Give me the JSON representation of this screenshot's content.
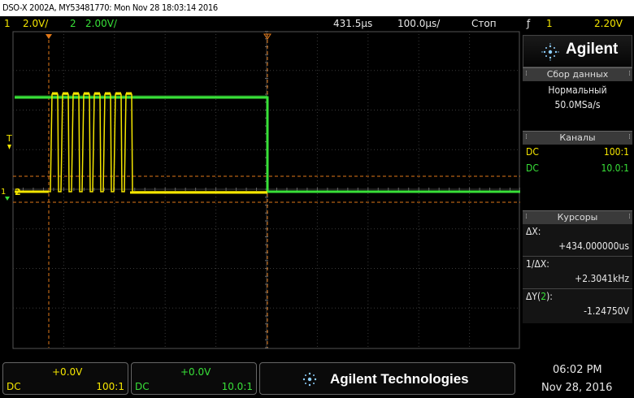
{
  "title_bar": "DSO-X 2002A, MY53481770: Mon Nov 28 18:03:14 2016",
  "status": {
    "ch1_num": "1",
    "ch1_scale": "2.0V/",
    "ch2_num": "2",
    "ch2_scale": "2.00V/",
    "time_pos": "431.5µs",
    "time_scale": "100.0µs/",
    "run_state": "Стоп",
    "trig_icon": "ƒ",
    "trig_ch": "1",
    "trig_level": "2.20V"
  },
  "markers": {
    "trigger_T": "T",
    "ch1_marker": "1",
    "ch2_marker": "2"
  },
  "panel": {
    "brand": "Agilent",
    "acq_header": "Сбор данных",
    "acq_mode": "Нормальный",
    "acq_rate": "50.0MSa/s",
    "channels_header": "Каналы",
    "channels": [
      {
        "coupling": "DC",
        "probe": "100:1",
        "color": "#f5e600"
      },
      {
        "coupling": "DC",
        "probe": "10.0:1",
        "color": "#38e038"
      }
    ],
    "cursors_header": "Курсоры",
    "cursors": {
      "dx_label": "ΔX:",
      "dx_value": "+434.000000us",
      "inv_dx_label": "1/ΔX:",
      "inv_dx_value": "+2.3041kHz",
      "dy_label_pre": "ΔY(",
      "dy_label_ch": "2",
      "dy_label_post": "):",
      "dy_value": "-1.24750V"
    }
  },
  "bottom": {
    "ch1_offset": "+0.0V",
    "ch1_coupling": "DC",
    "ch1_probe": "100:1",
    "ch2_offset": "+0.0V",
    "ch2_coupling": "DC",
    "ch2_probe": "10.0:1",
    "brand_full": "Agilent Technologies",
    "time": "06:02 PM",
    "date": "Nov 28, 2016"
  },
  "colors": {
    "ch1": "#f5e600",
    "ch2": "#38e038",
    "cursor": "#e07818",
    "grid": "#3a3a3a"
  },
  "icons": [
    "agilent-spark-icon",
    "trigger-arrow-icon",
    "ground-marker-icon"
  ]
}
